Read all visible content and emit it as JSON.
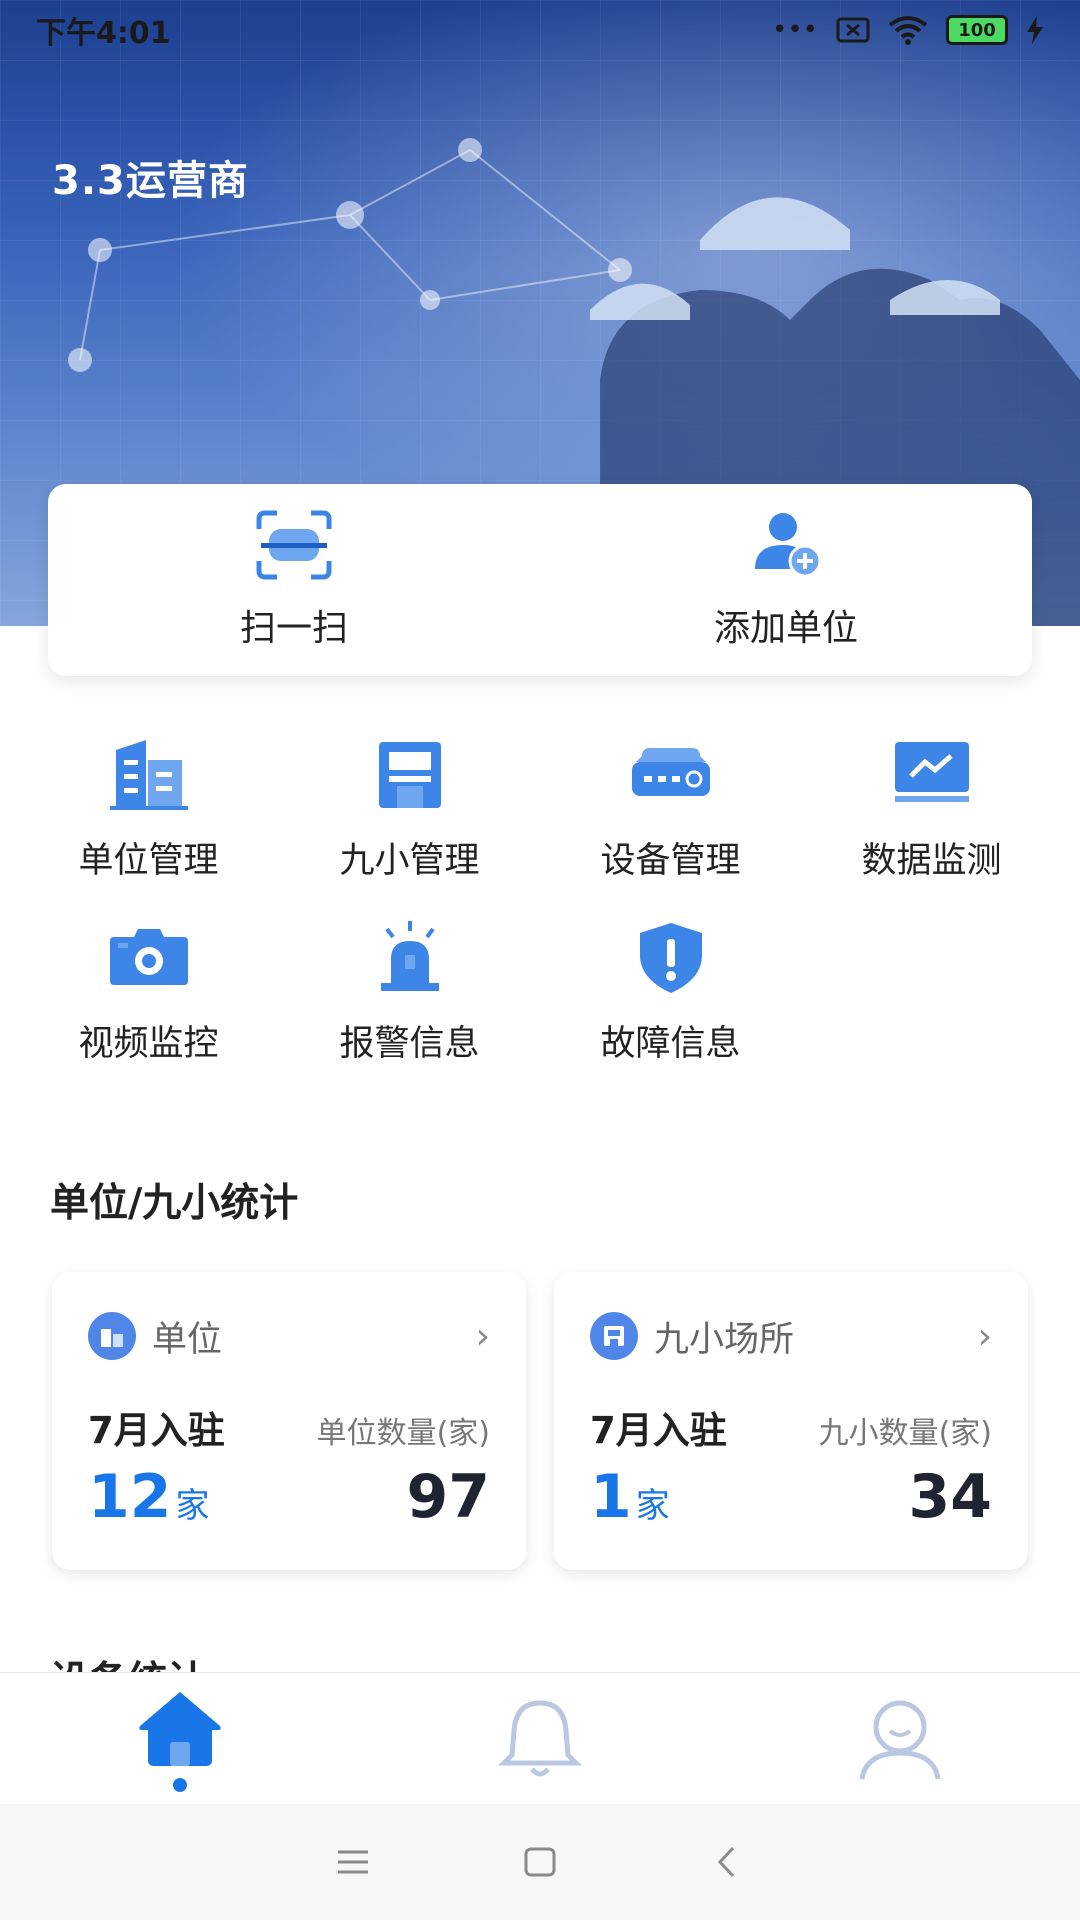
{
  "status_bar": {
    "time": "下午4:01",
    "signal": "•••",
    "battery": "100"
  },
  "header": {
    "title": "3.3运营商"
  },
  "quick_actions": [
    {
      "label": "扫一扫",
      "icon": "scan-icon"
    },
    {
      "label": "添加单位",
      "icon": "add-user-icon"
    }
  ],
  "menu": [
    {
      "label": "单位管理",
      "icon": "building-icon"
    },
    {
      "label": "九小管理",
      "icon": "shop-icon"
    },
    {
      "label": "设备管理",
      "icon": "device-icon"
    },
    {
      "label": "数据监测",
      "icon": "monitor-chart-icon"
    },
    {
      "label": "视频监控",
      "icon": "camera-icon"
    },
    {
      "label": "报警信息",
      "icon": "alarm-light-icon"
    },
    {
      "label": "故障信息",
      "icon": "shield-alert-icon"
    }
  ],
  "sections": {
    "unit_stats_title": "单位/九小统计",
    "device_stats_title": "设备统计"
  },
  "cards": [
    {
      "title": "单位",
      "month_label": "7月入驻",
      "count_label": "单位数量(家)",
      "month_value": "12",
      "unit": "家",
      "total": "97"
    },
    {
      "title": "九小场所",
      "month_label": "7月入驻",
      "count_label": "九小数量(家)",
      "month_value": "1",
      "unit": "家",
      "total": "34"
    }
  ],
  "colors": {
    "accent": "#1976e8",
    "icon_blue": "#3d85e6"
  }
}
